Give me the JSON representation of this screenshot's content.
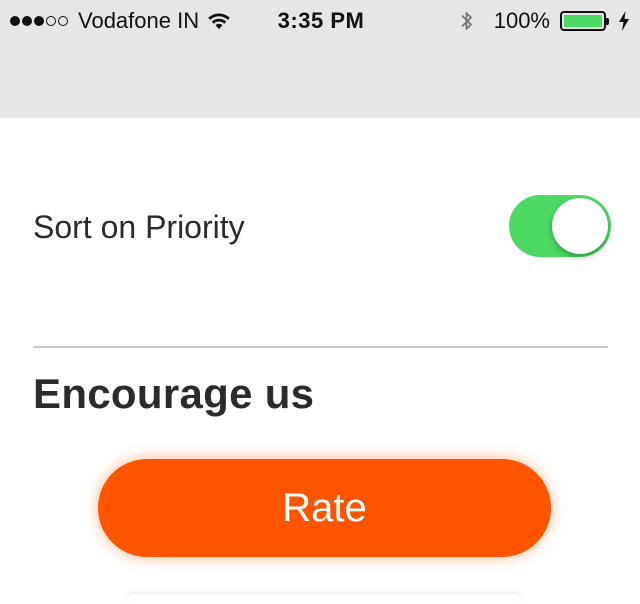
{
  "status_bar": {
    "signal_filled": 3,
    "signal_total": 5,
    "carrier": "Vodafone IN",
    "time": "3:35 PM",
    "battery_percent": "100%",
    "battery_level": 1.0,
    "battery_color": "#4cd964"
  },
  "settings": {
    "sort_label": "Sort on Priority",
    "sort_enabled": true,
    "toggle_on_color": "#4cd964"
  },
  "encourage": {
    "title": "Encourage us",
    "rate_label": "Rate",
    "accent_color": "#ff5500"
  },
  "icons": {
    "wifi": "wifi-icon",
    "bluetooth": "bluetooth-icon",
    "battery": "battery-icon",
    "charging": "charging-bolt-icon"
  }
}
